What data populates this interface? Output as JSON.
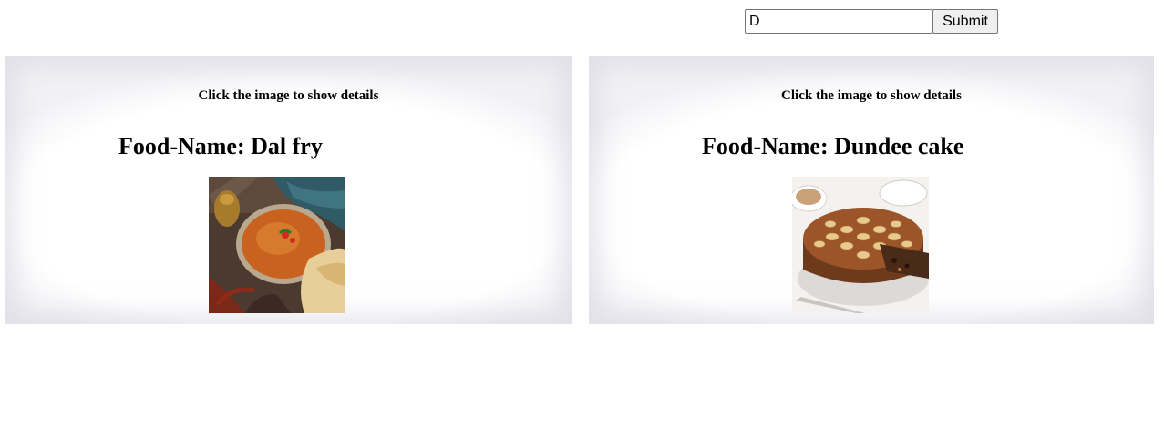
{
  "search": {
    "value": "D",
    "submit_label": "Submit"
  },
  "cards": [
    {
      "hint": "Click the image to show details",
      "title": "Food-Name: Dal fry",
      "image_alt": "Dal fry"
    },
    {
      "hint": "Click the image to show details",
      "title": "Food-Name: Dundee cake",
      "image_alt": "Dundee cake"
    }
  ]
}
